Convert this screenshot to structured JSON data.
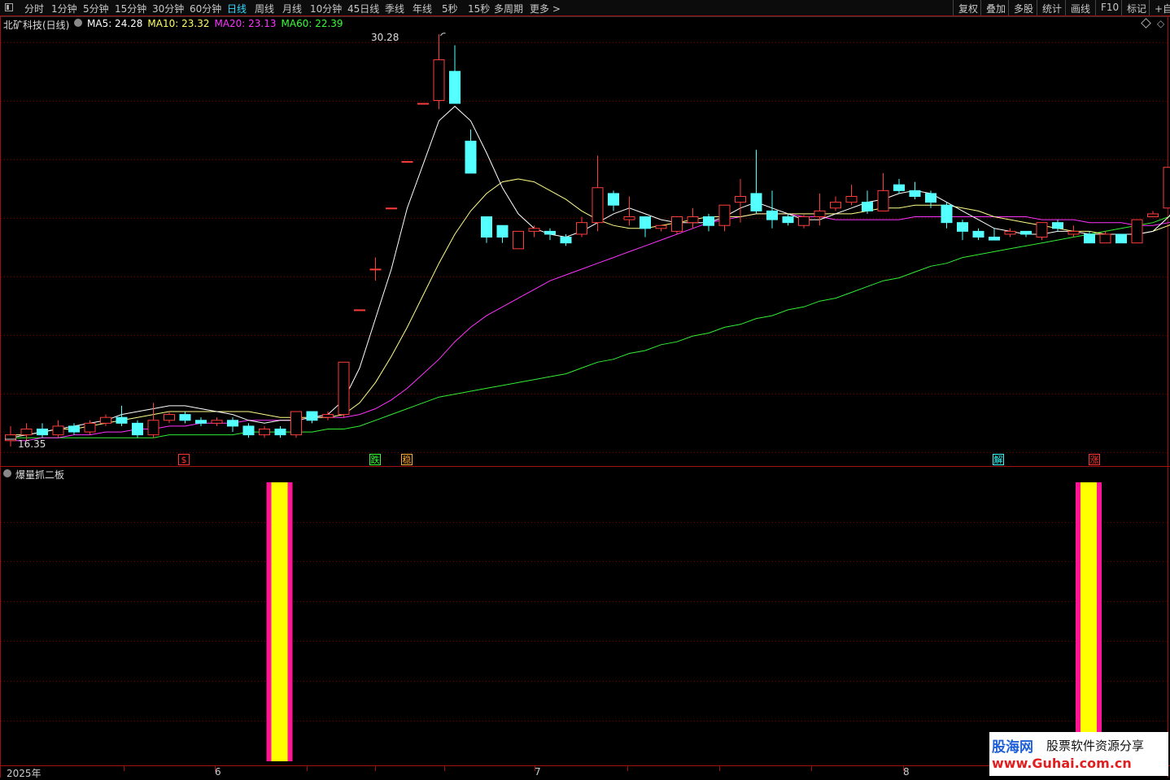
{
  "toolbar": {
    "periods": [
      "分时",
      "1分钟",
      "5分钟",
      "15分钟",
      "30分钟",
      "60分钟",
      "日线",
      "周线",
      "月线",
      "10分钟",
      "45日线",
      "季线",
      "年线",
      "5秒",
      "15秒",
      "多周期",
      "更多 >"
    ],
    "active_period": "日线",
    "right_buttons": [
      "复权",
      "叠加",
      "多股",
      "统计",
      "画线",
      "F10",
      "标记",
      "+自"
    ]
  },
  "main_panel": {
    "stock_title": "北矿科技(日线)",
    "ma": [
      {
        "label": "MA5: 24.28",
        "color": "#ffffff"
      },
      {
        "label": "MA10: 23.32",
        "color": "#ffff66"
      },
      {
        "label": "MA20: 23.13",
        "color": "#ff33ff"
      },
      {
        "label": "MA60: 22.39",
        "color": "#33ff33"
      }
    ],
    "high_label": "30.28",
    "low_label": "16.35",
    "corner_icons": [
      "diamond-icon",
      "expand-icon"
    ]
  },
  "signals": [
    {
      "text": "$",
      "color": "#ff3333"
    },
    {
      "text": "跌",
      "color": "#33ff33"
    },
    {
      "text": "稳",
      "color": "#ffaa33"
    },
    {
      "text": "解",
      "color": "#33ffff"
    },
    {
      "text": "涨",
      "color": "#ff3333"
    }
  ],
  "indicator_panel": {
    "title": "爆量抓二板",
    "bar_colors": {
      "outer": "#ff1493",
      "inner": "#ffff00"
    }
  },
  "time_axis": [
    "2025年",
    "6",
    "7",
    "8"
  ],
  "watermark": {
    "brand": "股海网",
    "slogan": "股票软件资源分享",
    "url": "www.Guhai.com.cn"
  },
  "colors": {
    "up": "#ff3c3c",
    "down": "#54ffff",
    "grid": "#7a0000"
  },
  "chart_data": {
    "type": "candlestick",
    "ylim": [
      16.35,
      30.28
    ],
    "candles": [
      [
        16.3,
        16.5,
        16.1,
        16.8
      ],
      [
        16.5,
        16.7,
        16.3,
        16.9
      ],
      [
        16.7,
        16.5,
        16.4,
        16.9
      ],
      [
        16.5,
        16.8,
        16.4,
        17.0
      ],
      [
        16.8,
        16.6,
        16.5,
        16.9
      ],
      [
        16.6,
        16.9,
        16.5,
        17.0
      ],
      [
        16.9,
        17.1,
        16.8,
        17.2
      ],
      [
        17.1,
        16.9,
        16.8,
        17.5
      ],
      [
        16.9,
        16.5,
        16.4,
        17.0
      ],
      [
        16.5,
        17.0,
        16.4,
        17.6
      ],
      [
        17.0,
        17.2,
        16.9,
        17.3
      ],
      [
        17.2,
        17.0,
        16.9,
        17.3
      ],
      [
        17.0,
        16.9,
        16.8,
        17.1
      ],
      [
        16.9,
        17.0,
        16.8,
        17.1
      ],
      [
        17.0,
        16.8,
        16.6,
        17.1
      ],
      [
        16.8,
        16.5,
        16.4,
        16.9
      ],
      [
        16.5,
        16.7,
        16.4,
        16.8
      ],
      [
        16.7,
        16.5,
        16.4,
        16.8
      ],
      [
        16.5,
        17.3,
        16.4,
        17.3
      ],
      [
        17.3,
        17.0,
        16.9,
        17.3
      ],
      [
        17.1,
        17.2,
        17.0,
        17.3
      ],
      [
        17.2,
        19.0,
        17.1,
        19.0
      ],
      [
        20.8,
        20.8,
        20.8,
        20.8
      ],
      [
        22.2,
        22.2,
        21.8,
        22.6
      ],
      [
        24.3,
        24.3,
        24.3,
        24.3
      ],
      [
        25.9,
        25.9,
        25.9,
        25.9
      ],
      [
        27.9,
        27.9,
        27.9,
        27.9
      ],
      [
        28.0,
        29.4,
        27.7,
        30.28
      ],
      [
        29.0,
        27.9,
        27.9,
        29.9
      ],
      [
        26.6,
        25.5,
        25.5,
        27.0
      ],
      [
        24.0,
        23.3,
        23.1,
        24.0
      ],
      [
        23.7,
        23.3,
        23.1,
        23.7
      ],
      [
        22.9,
        23.5,
        22.9,
        23.5
      ],
      [
        23.5,
        23.6,
        23.3,
        23.7
      ],
      [
        23.5,
        23.4,
        23.2,
        23.6
      ],
      [
        23.3,
        23.1,
        23.0,
        23.4
      ],
      [
        23.4,
        23.8,
        23.3,
        24.0
      ],
      [
        23.8,
        25.0,
        23.5,
        26.1
      ],
      [
        24.8,
        24.4,
        24.2,
        24.9
      ],
      [
        23.9,
        24.0,
        23.7,
        24.7
      ],
      [
        24.0,
        23.6,
        23.3,
        24.0
      ],
      [
        23.6,
        23.7,
        23.5,
        23.7
      ],
      [
        23.5,
        24.0,
        23.4,
        24.0
      ],
      [
        23.8,
        24.0,
        23.6,
        24.3
      ],
      [
        24.0,
        23.7,
        23.5,
        24.1
      ],
      [
        23.7,
        24.4,
        23.5,
        24.4
      ],
      [
        24.5,
        24.7,
        23.8,
        25.3
      ],
      [
        24.8,
        24.2,
        24.1,
        26.3
      ],
      [
        24.2,
        23.9,
        23.6,
        24.9
      ],
      [
        24.0,
        23.8,
        23.7,
        24.1
      ],
      [
        23.7,
        24.0,
        23.6,
        24.1
      ],
      [
        24.0,
        24.2,
        23.7,
        24.8
      ],
      [
        24.3,
        24.5,
        24.2,
        24.7
      ],
      [
        24.5,
        24.7,
        24.4,
        25.1
      ],
      [
        24.5,
        24.2,
        24.1,
        24.9
      ],
      [
        24.2,
        24.9,
        24.2,
        25.5
      ],
      [
        25.1,
        24.9,
        24.8,
        25.3
      ],
      [
        24.9,
        24.7,
        24.6,
        25.2
      ],
      [
        24.8,
        24.5,
        24.3,
        24.9
      ],
      [
        24.4,
        23.8,
        23.6,
        24.5
      ],
      [
        23.8,
        23.5,
        23.2,
        23.9
      ],
      [
        23.5,
        23.3,
        23.2,
        23.6
      ],
      [
        23.3,
        23.2,
        23.2,
        23.6
      ],
      [
        23.4,
        23.5,
        23.3,
        23.6
      ],
      [
        23.5,
        23.4,
        23.3,
        23.5
      ],
      [
        23.3,
        23.8,
        23.2,
        23.8
      ],
      [
        23.8,
        23.6,
        23.5,
        23.9
      ],
      [
        23.4,
        23.5,
        23.3,
        23.7
      ],
      [
        23.4,
        23.1,
        23.1,
        23.5
      ],
      [
        23.1,
        23.4,
        23.1,
        23.5
      ],
      [
        23.4,
        23.1,
        23.1,
        23.4
      ],
      [
        23.1,
        23.9,
        23.1,
        23.9
      ],
      [
        24.0,
        24.1,
        24.0,
        24.2
      ],
      [
        24.3,
        25.7,
        24.3,
        25.7
      ],
      [
        26.7,
        28.2,
        26.1,
        28.2
      ]
    ],
    "ma5": [
      16.4,
      16.5,
      16.6,
      16.7,
      16.8,
      16.9,
      17.0,
      17.2,
      17.3,
      17.4,
      17.5,
      17.5,
      17.4,
      17.3,
      17.2,
      17.0,
      16.9,
      17.0,
      17.0,
      17.1,
      17.2,
      17.7,
      18.8,
      20.5,
      22.2,
      24.3,
      25.8,
      27.3,
      27.8,
      27.3,
      26.2,
      25.0,
      24.1,
      23.6,
      23.4,
      23.3,
      23.5,
      23.8,
      24.1,
      24.3,
      24.1,
      23.9,
      23.8,
      23.8,
      23.8,
      24.0,
      24.3,
      24.5,
      24.3,
      24.1,
      23.9,
      23.9,
      24.1,
      24.3,
      24.5,
      24.6,
      24.8,
      24.9,
      24.8,
      24.5,
      24.2,
      23.9,
      23.6,
      23.5,
      23.4,
      23.4,
      23.5,
      23.5,
      23.4,
      23.4,
      23.4,
      23.4,
      23.5,
      24.0,
      24.8
    ],
    "ma10": [
      16.5,
      16.5,
      16.6,
      16.7,
      16.7,
      16.8,
      16.9,
      17.0,
      17.1,
      17.2,
      17.3,
      17.3,
      17.3,
      17.3,
      17.3,
      17.3,
      17.2,
      17.1,
      17.1,
      17.1,
      17.1,
      17.2,
      17.6,
      18.3,
      19.2,
      20.2,
      21.3,
      22.4,
      23.4,
      24.2,
      24.8,
      25.2,
      25.3,
      25.2,
      24.9,
      24.6,
      24.2,
      23.9,
      23.7,
      23.6,
      23.6,
      23.7,
      23.8,
      23.9,
      24.0,
      24.0,
      24.0,
      24.1,
      24.1,
      24.1,
      24.1,
      24.1,
      24.1,
      24.1,
      24.2,
      24.3,
      24.3,
      24.4,
      24.4,
      24.4,
      24.3,
      24.2,
      24.0,
      23.9,
      23.8,
      23.7,
      23.6,
      23.5,
      23.5,
      23.4,
      23.4,
      23.4,
      23.5,
      23.7,
      24.0
    ],
    "ma20": [
      16.3,
      16.3,
      16.4,
      16.4,
      16.5,
      16.5,
      16.6,
      16.6,
      16.7,
      16.7,
      16.8,
      16.8,
      16.9,
      16.9,
      16.9,
      17.0,
      17.0,
      17.0,
      17.0,
      17.1,
      17.1,
      17.1,
      17.2,
      17.4,
      17.7,
      18.1,
      18.6,
      19.1,
      19.7,
      20.2,
      20.6,
      20.9,
      21.2,
      21.5,
      21.8,
      22.0,
      22.2,
      22.4,
      22.6,
      22.8,
      23.0,
      23.2,
      23.4,
      23.6,
      23.8,
      23.9,
      24.0,
      24.1,
      24.1,
      24.1,
      24.0,
      24.0,
      23.9,
      23.9,
      23.9,
      23.9,
      23.9,
      24.0,
      24.0,
      24.0,
      24.0,
      24.0,
      24.0,
      24.0,
      24.0,
      23.9,
      23.9,
      23.9,
      23.8,
      23.8,
      23.8,
      23.7,
      23.7,
      23.8,
      24.0
    ],
    "ma60": [
      16.4,
      16.4,
      16.4,
      16.4,
      16.4,
      16.4,
      16.4,
      16.4,
      16.4,
      16.4,
      16.5,
      16.5,
      16.5,
      16.5,
      16.5,
      16.6,
      16.6,
      16.6,
      16.6,
      16.6,
      16.7,
      16.7,
      16.8,
      17.0,
      17.2,
      17.4,
      17.6,
      17.8,
      17.9,
      18.0,
      18.1,
      18.2,
      18.3,
      18.4,
      18.5,
      18.6,
      18.8,
      19.0,
      19.1,
      19.3,
      19.4,
      19.6,
      19.7,
      19.9,
      20.0,
      20.2,
      20.3,
      20.5,
      20.6,
      20.8,
      20.9,
      21.1,
      21.2,
      21.4,
      21.6,
      21.8,
      21.9,
      22.1,
      22.3,
      22.4,
      22.6,
      22.7,
      22.8,
      22.9,
      23.0,
      23.1,
      23.2,
      23.3,
      23.4,
      23.5,
      23.6,
      23.7,
      23.8,
      24.0,
      24.3
    ],
    "indicator_bars": [
      17,
      68
    ]
  }
}
